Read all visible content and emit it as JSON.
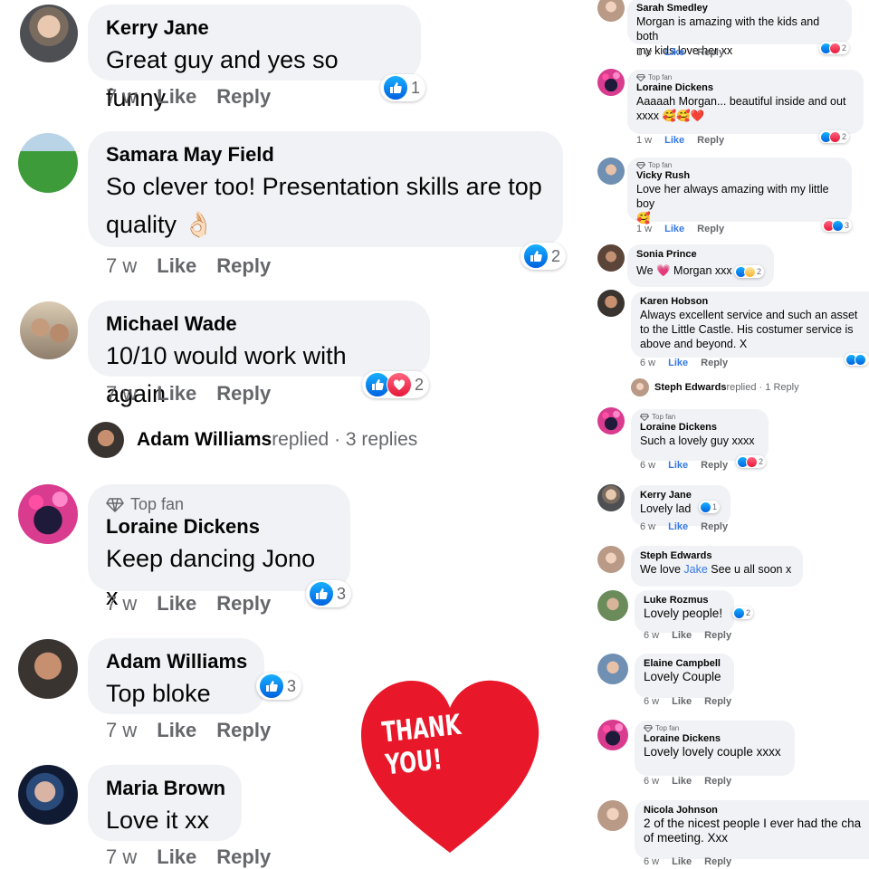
{
  "labels": {
    "like": "Like",
    "reply": "Reply",
    "top_fan": "Top fan",
    "thank_you": "THANK YOU!"
  },
  "left": {
    "comments": [
      {
        "name": "Kerry Jane",
        "lines": [
          "Great guy and yes so funny"
        ],
        "time": "7 w",
        "reactions": [
          "like"
        ],
        "count": "1"
      },
      {
        "name": "Samara May Field",
        "lines": [
          "So clever too! Presentation skills are top",
          "quality 👌🏻"
        ],
        "time": "7 w",
        "reactions": [
          "like"
        ],
        "count": "2"
      },
      {
        "name": "Michael Wade",
        "lines": [
          "10/10 would work with again"
        ],
        "time": "7 w",
        "reactions": [
          "like",
          "love"
        ],
        "count": "2"
      },
      {
        "name": "Loraine Dickens",
        "badge": "Top fan",
        "lines": [
          "Keep dancing Jono x"
        ],
        "time": "7 w",
        "reactions": [
          "like"
        ],
        "count": "3"
      },
      {
        "name": "Adam Williams",
        "lines": [
          "Top bloke"
        ],
        "time": "7 w",
        "reactions": [
          "like"
        ],
        "count": "3"
      },
      {
        "name": "Maria Brown",
        "lines": [
          "Love it xx"
        ],
        "time": "7 w"
      }
    ],
    "replied": {
      "name": "Adam Williams",
      "rest": " replied · 3 replies"
    }
  },
  "right": {
    "comments": [
      {
        "name": "Sarah Smedley",
        "lines": [
          "Morgan is amazing with the kids and both",
          "my kids love her xx"
        ],
        "time": "1 w",
        "reactions": [
          "like",
          "love"
        ],
        "count": "2"
      },
      {
        "name": "Loraine Dickens",
        "badge": "Top fan",
        "lines": [
          "Aaaaah Morgan... beautiful inside and out",
          "xxxx 🥰🥰❤️"
        ],
        "time": "1 w",
        "reactions": [
          "like",
          "love"
        ],
        "count": "2"
      },
      {
        "name": "Vicky Rush",
        "badge": "Top fan",
        "lines": [
          "Love her always amazing with my little boy",
          "🥰"
        ],
        "time": "1 w",
        "reactions": [
          "love",
          "like"
        ],
        "count": "3"
      },
      {
        "name": "Sonia Prince",
        "lines": [
          "We 💗 Morgan xxx"
        ],
        "reactions": [
          "like",
          "care"
        ],
        "count": "2"
      },
      {
        "name": "Karen Hobson",
        "lines": [
          "Always excellent service and such an asset",
          "to the Little Castle. His costumer service is",
          "above and beyond. X"
        ],
        "time": "6 w",
        "reactions": [
          "like",
          "like"
        ],
        "count": ""
      },
      {
        "name": "Loraine Dickens",
        "badge": "Top fan",
        "lines": [
          "Such a lovely guy xxxx"
        ],
        "time": "6 w",
        "reactions": [
          "like",
          "love"
        ],
        "count": "2"
      },
      {
        "name": "Kerry Jane",
        "lines": [
          "Lovely lad"
        ],
        "time": "6 w",
        "reactions": [
          "like"
        ],
        "count": "1"
      },
      {
        "name": "Steph Edwards",
        "lines_rich": {
          "before": "We love ",
          "link": "Jake",
          "after": " See u all soon x"
        }
      },
      {
        "name": "Luke Rozmus",
        "lines": [
          "Lovely people!"
        ],
        "time": "6 w",
        "reactions": [
          "like"
        ],
        "count": "2"
      },
      {
        "name": "Elaine Campbell",
        "lines": [
          "Lovely Couple"
        ],
        "time": "6 w"
      },
      {
        "name": "Loraine Dickens",
        "badge": "Top fan",
        "lines": [
          "Lovely lovely couple xxxx"
        ],
        "time": "6 w"
      },
      {
        "name": "Nicola Johnson",
        "lines": [
          "2 of the nicest people I ever had the cha",
          "of meeting. Xxx"
        ],
        "time": "6 w"
      }
    ],
    "replied": {
      "name": "Steph Edwards",
      "rest": " replied · 1 Reply"
    }
  },
  "icons": {
    "like": "thumbs-up-icon",
    "love": "heart-icon",
    "care": "care-icon",
    "badge": "diamond-icon"
  },
  "colors": {
    "like": "#1877f2",
    "love": "#f33e58",
    "bubble": "#f0f2f5",
    "meta": "#65676b",
    "heart": "#e8182a"
  }
}
